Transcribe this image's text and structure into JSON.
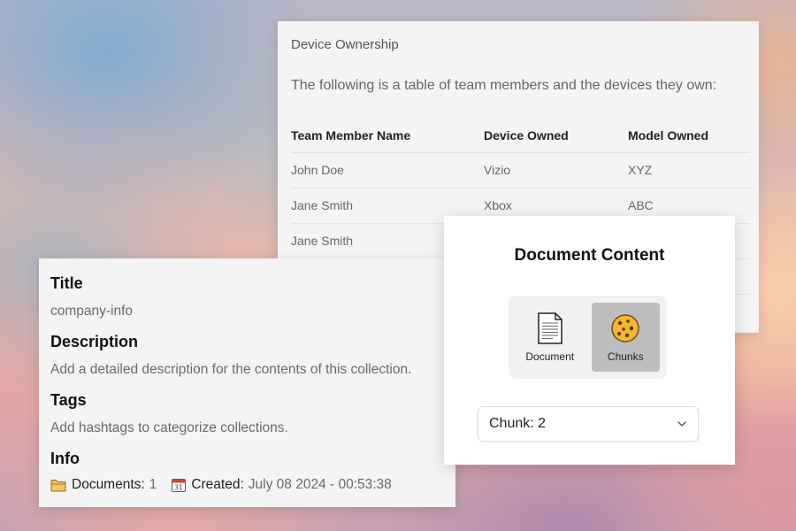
{
  "device_ownership": {
    "title": "Device Ownership",
    "intro": "The following is a table of team members and the devices they own:",
    "columns": [
      "Team Member Name",
      "Device Owned",
      "Model Owned"
    ],
    "rows": [
      [
        "John Doe",
        "Vizio",
        "XYZ"
      ],
      [
        "Jane Smith",
        "Xbox",
        "ABC"
      ],
      [
        "Jane Smith",
        "",
        ""
      ]
    ]
  },
  "collection_info": {
    "title_heading": "Title",
    "title_value": "company-info",
    "description_heading": "Description",
    "description_placeholder": "Add a detailed description for the contents of this collection.",
    "tags_heading": "Tags",
    "tags_placeholder": "Add hashtags to categorize collections.",
    "info_heading": "Info",
    "documents_icon": "folder-icon",
    "documents_label": "Documents:",
    "documents_count": "1",
    "created_icon": "calendar-icon",
    "created_label": "Created:",
    "created_value": "July 08 2024 - 00:53:38"
  },
  "document_content": {
    "title": "Document Content",
    "toggle": [
      {
        "label": "Document",
        "icon": "document-icon",
        "active": false
      },
      {
        "label": "Chunks",
        "icon": "cookie-icon",
        "active": true
      }
    ],
    "chunk_select": {
      "value": "Chunk: 2",
      "icon": "chevron-down-icon"
    }
  },
  "colors": {
    "panel_bg": "#f4f4f4",
    "active_toggle": "#bdbdbd",
    "heading_text": "#111111",
    "muted_text": "#6a6a6a"
  }
}
